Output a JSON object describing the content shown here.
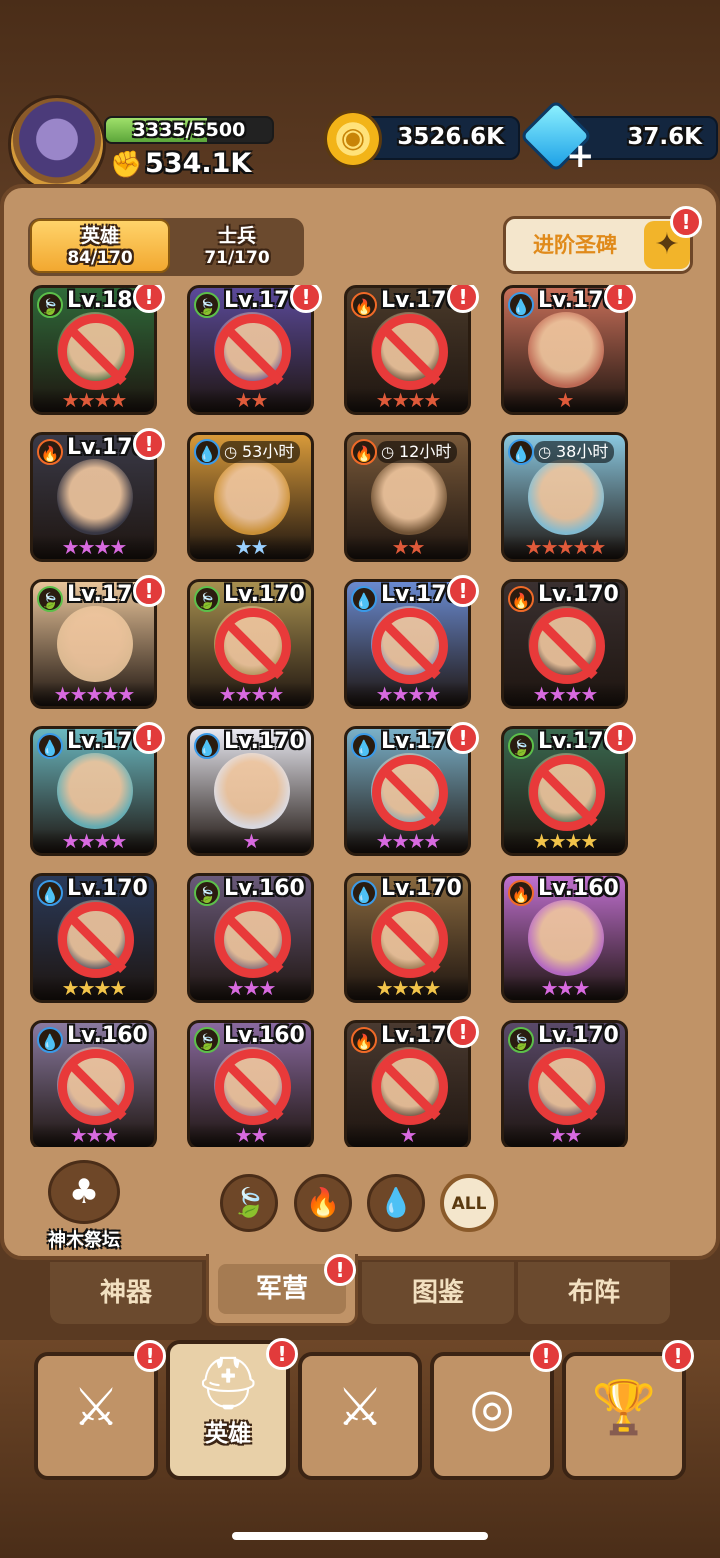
{
  "header": {
    "avatar_icon": "hero-avatar-icon",
    "hp_text": "3335/5500",
    "hp_fraction": 0.606,
    "power": "534.1K",
    "coins": "3526.6K",
    "gems": "37.6K"
  },
  "tabs": {
    "hero_label": "英雄",
    "hero_count": "84/170",
    "soldier_label": "士兵",
    "soldier_count": "71/170"
  },
  "stele_button": {
    "label": "进阶圣碑"
  },
  "badge_text": "!",
  "heroes": [
    {
      "element": "leaf",
      "level": "Lv.180",
      "stars": 4,
      "star_color": "#e05a3a",
      "locked": true,
      "alert": true,
      "bg": "#2f6b3a"
    },
    {
      "element": "leaf",
      "level": "Lv.170",
      "stars": 2,
      "star_color": "#e05a3a",
      "locked": true,
      "alert": true,
      "bg": "#5b4a9a"
    },
    {
      "element": "fire",
      "level": "Lv.170",
      "stars": 4,
      "star_color": "#e05a3a",
      "locked": true,
      "alert": true,
      "bg": "#4a3a2a"
    },
    {
      "element": "water",
      "level": "Lv.170",
      "stars": 1,
      "star_color": "#e05a3a",
      "locked": false,
      "alert": true,
      "bg": "#c9705a"
    },
    {
      "element": "fire",
      "level": "Lv.170",
      "stars": 4,
      "star_color": "#d86ae0",
      "locked": false,
      "alert": true,
      "bg": "#3a3a48"
    },
    {
      "element": "water",
      "timer": "53小时",
      "stars": 2,
      "star_color": "#9ad0ff",
      "locked": false,
      "alert": false,
      "bg": "#d89a3a"
    },
    {
      "element": "fire",
      "timer": "12小时",
      "stars": 2,
      "star_color": "#e05a3a",
      "locked": false,
      "alert": false,
      "bg": "#7a5a3a"
    },
    {
      "element": "water",
      "timer": "38小时",
      "stars": 5,
      "star_color": "#e05a3a",
      "locked": false,
      "alert": false,
      "bg": "#8ac8e0"
    },
    {
      "element": "leaf",
      "level": "Lv.170",
      "stars": 5,
      "star_color": "#d86ae0",
      "locked": false,
      "alert": true,
      "bg": "#e8c49a"
    },
    {
      "element": "leaf",
      "level": "Lv.170",
      "stars": 4,
      "star_color": "#d86ae0",
      "locked": true,
      "alert": false,
      "bg": "#a89050"
    },
    {
      "element": "water",
      "level": "Lv.170",
      "stars": 4,
      "star_color": "#d86ae0",
      "locked": true,
      "alert": true,
      "bg": "#6a8ad0"
    },
    {
      "element": "fire",
      "level": "Lv.170",
      "stars": 4,
      "star_color": "#d86ae0",
      "locked": true,
      "alert": false,
      "bg": "#3a3030"
    },
    {
      "element": "water",
      "level": "Lv.170",
      "stars": 4,
      "star_color": "#d86ae0",
      "locked": false,
      "alert": true,
      "bg": "#6ab8c0"
    },
    {
      "element": "water",
      "level": "Lv.170",
      "stars": 1,
      "star_color": "#d86ae0",
      "locked": false,
      "alert": false,
      "bg": "#e8e8f0"
    },
    {
      "element": "water",
      "level": "Lv.170",
      "stars": 4,
      "star_color": "#d86ae0",
      "locked": true,
      "alert": true,
      "bg": "#7ab0c8"
    },
    {
      "element": "leaf",
      "level": "Lv.170",
      "stars": 4,
      "star_color": "#f2c44a",
      "locked": true,
      "alert": true,
      "bg": "#3a6a50"
    },
    {
      "element": "water",
      "level": "Lv.170",
      "stars": 4,
      "star_color": "#f2c44a",
      "locked": true,
      "alert": false,
      "bg": "#2a3a5a"
    },
    {
      "element": "leaf",
      "level": "Lv.160",
      "stars": 3,
      "star_color": "#d86ae0",
      "locked": true,
      "alert": false,
      "bg": "#6a5a7a"
    },
    {
      "element": "water",
      "level": "Lv.170",
      "stars": 4,
      "star_color": "#f2c44a",
      "locked": true,
      "alert": false,
      "bg": "#8a6a40"
    },
    {
      "element": "fire",
      "level": "Lv.160",
      "stars": 3,
      "star_color": "#d86ae0",
      "locked": false,
      "alert": false,
      "bg": "#c070d0"
    },
    {
      "element": "water",
      "level": "Lv.160",
      "stars": 3,
      "star_color": "#d86ae0",
      "locked": true,
      "alert": false,
      "bg": "#8a7aa0"
    },
    {
      "element": "leaf",
      "level": "Lv.160",
      "stars": 2,
      "star_color": "#d86ae0",
      "locked": true,
      "alert": false,
      "bg": "#8a6aa0"
    },
    {
      "element": "fire",
      "level": "Lv.170",
      "stars": 1,
      "star_color": "#d86ae0",
      "locked": true,
      "alert": true,
      "bg": "#4a3a30"
    },
    {
      "element": "leaf",
      "level": "Lv.170",
      "stars": 2,
      "star_color": "#d86ae0",
      "locked": true,
      "alert": false,
      "bg": "#5a4a6a"
    }
  ],
  "element_icons": {
    "leaf": "🍃",
    "fire": "🔥",
    "water": "💧"
  },
  "element_colors": {
    "leaf": "#5cc04a",
    "fire": "#f06a28",
    "water": "#3a9ae8"
  },
  "altar": {
    "label": "神木祭坛",
    "icon": "tree-altar-icon"
  },
  "filters": {
    "all_label": "ALL"
  },
  "nav_tabs": {
    "artifact": "神器",
    "camp": "军营",
    "codex": "图鉴",
    "formation": "布阵"
  },
  "bottom_nav": {
    "hero_label": "英雄"
  }
}
